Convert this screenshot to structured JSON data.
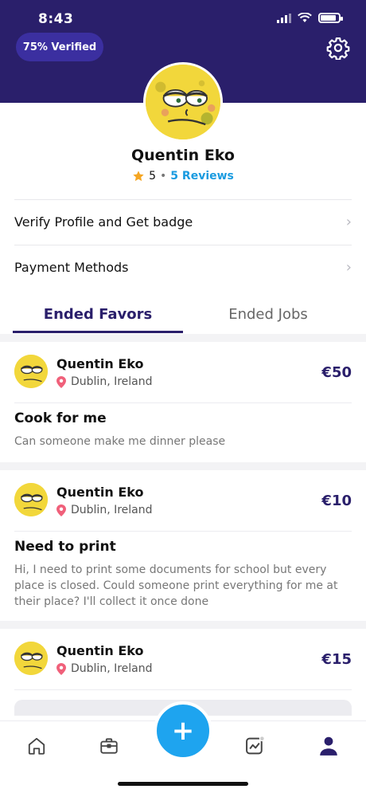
{
  "status_bar": {
    "time": "8:43",
    "battery_level": 0.85
  },
  "header": {
    "verified_label": "75% Verified"
  },
  "profile": {
    "name": "Quentin Eko",
    "rating": "5",
    "separator": "•",
    "reviews_label": "5 Reviews"
  },
  "menu": [
    {
      "label": "Verify Profile and Get badge"
    },
    {
      "label": "Payment Methods"
    }
  ],
  "tabs": [
    {
      "label": "Ended Favors",
      "active": true
    },
    {
      "label": "Ended Jobs",
      "active": false
    }
  ],
  "cards": [
    {
      "name": "Quentin Eko",
      "location": "Dublin, Ireland",
      "price": "€50",
      "title": "Cook for me",
      "description": "Can someone make me dinner please"
    },
    {
      "name": "Quentin Eko",
      "location": "Dublin, Ireland",
      "price": "€10",
      "title": "Need to print",
      "description": "Hi, I need to print some documents for school but every place is closed. Could someone print everything for me at their place? I'll collect it once done"
    },
    {
      "name": "Quentin Eko",
      "location": "Dublin, Ireland",
      "price": "€15"
    }
  ],
  "fab_label": "+",
  "colors": {
    "brand_dark": "#2a1f6b",
    "accent_blue": "#1ea4ef",
    "link_blue": "#1a9be0",
    "star": "#f5a623",
    "pin": "#f0607a"
  },
  "icons": {
    "settings": "gear-icon",
    "rating": "star-icon",
    "location": "location-pin-icon",
    "nav": [
      "home-icon",
      "briefcase-icon",
      "chart-icon",
      "profile-icon"
    ]
  }
}
